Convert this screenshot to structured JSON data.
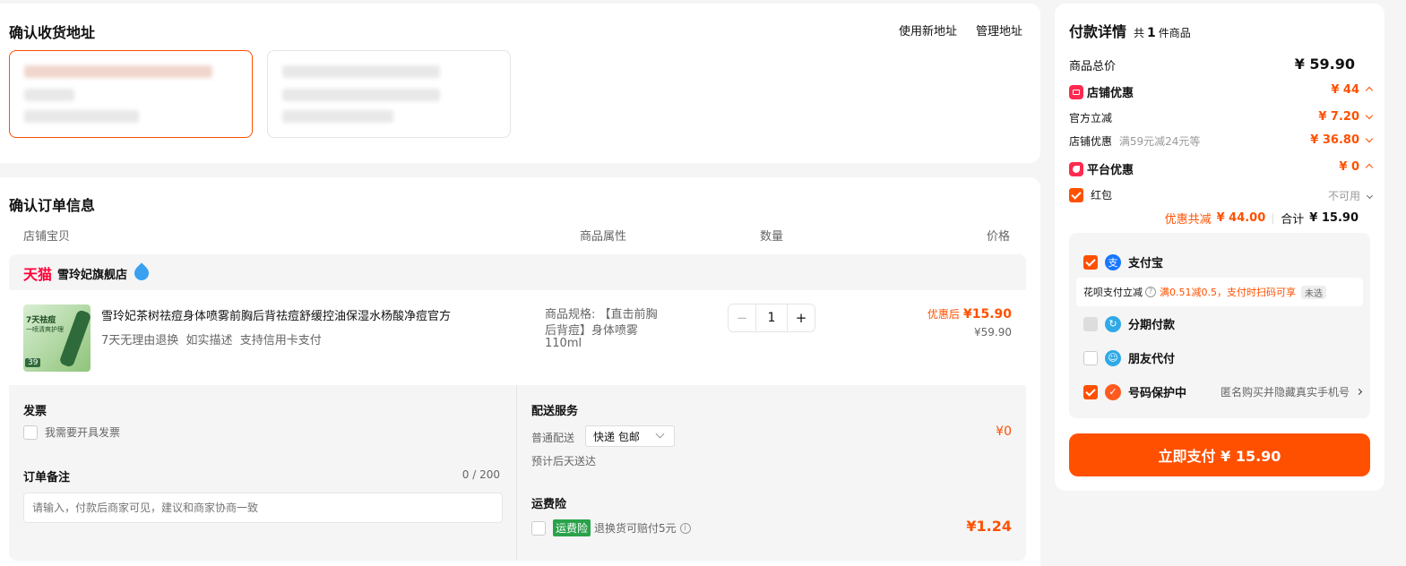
{
  "address": {
    "title": "确认收货地址",
    "use_new": "使用新地址",
    "manage": "管理地址"
  },
  "order": {
    "title": "确认订单信息",
    "columns": [
      "店铺宝贝",
      "商品属性",
      "数量",
      "价格"
    ],
    "shop_brand": "天猫",
    "shop_name": "雪玲妃旗舰店",
    "product": {
      "name": "雪玲妃茶树祛痘身体喷雾前胸后背祛痘舒缓控油保湿水杨酸净痘官方",
      "tags": "7天无理由退换  如实描述  支持信用卡支付",
      "spec_line1": "商品规格: 【直击前胸",
      "spec_line2": "后背痘】身体喷雾",
      "spec_line3": "110ml",
      "quantity": "1",
      "minus": "−",
      "plus": "+",
      "price_label": "优惠后",
      "price_after": "¥15.90",
      "price_original": "¥59.90",
      "thumb_text1": "7天祛痘",
      "thumb_text2": "一喷清爽护理",
      "thumb_price": "39"
    },
    "invoice": {
      "title": "发票",
      "option": "我需要开具发票"
    },
    "note": {
      "title": "订单备注",
      "count": "0 / 200",
      "placeholder": "请输入，付款后商家可见，建议和商家协商一致"
    },
    "delivery": {
      "title": "配送服务",
      "label": "普通配送",
      "option": "快递 包邮",
      "eta": "预计后天送达",
      "price": "¥0"
    },
    "insurance": {
      "title": "运费险",
      "badge": "运费险",
      "desc": "退换货可赔付5元",
      "price": "¥1.24"
    }
  },
  "payment": {
    "title": "付款详情",
    "count_prefix": "共",
    "count": "1",
    "count_suffix": "件商品",
    "goods_total_label": "商品总价",
    "goods_total": "¥ 59.90",
    "shop_discount_label": "店铺优惠",
    "shop_discount": "¥ 44",
    "official_label": "官方立减",
    "official": "¥ 7.20",
    "shop_coupon_label": "店铺优惠",
    "shop_coupon_desc": "满59元减24元等",
    "shop_coupon": "¥ 36.80",
    "platform_label": "平台优惠",
    "platform": "¥ 0",
    "redpacket_label": "红包",
    "redpacket_status": "不可用",
    "saved_label": "优惠共减",
    "saved": "¥ 44.00",
    "total_label": "合计",
    "total": "¥ 15.90",
    "methods": {
      "alipay": "支付宝",
      "huabei_label": "花呗支付立减",
      "huabei_desc": "满0.51减0.5，支付时扫码可享",
      "huabei_badge": "未选",
      "installment": "分期付款",
      "friend": "朋友代付",
      "privacy": "号码保护中",
      "privacy_desc": "匿名购买并隐藏真实手机号"
    },
    "pay_button": "立即支付 ¥ 15.90"
  },
  "colors": {
    "accent": "#ff5000",
    "tmall_red": "#ff0036",
    "alipay_blue": "#1677ff",
    "insurance_green": "#2aa24a"
  }
}
